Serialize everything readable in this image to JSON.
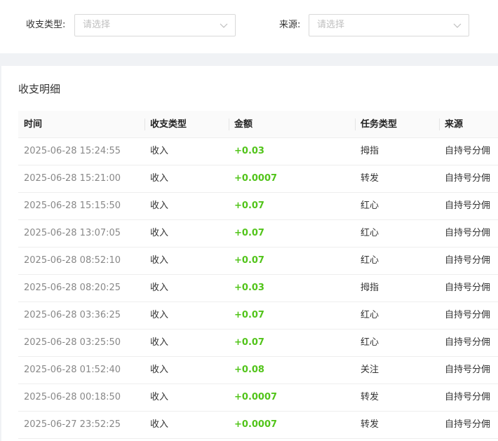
{
  "filters": {
    "type_label": "收支类型:",
    "type_placeholder": "请选择",
    "source_label": "来源:",
    "source_placeholder": "请选择"
  },
  "panel": {
    "title": "收支明细"
  },
  "table": {
    "columns": [
      "时间",
      "收支类型",
      "金额",
      "任务类型",
      "来源"
    ],
    "rows": [
      {
        "time": "2025-06-28 15:24:55",
        "type": "收入",
        "amount": "+0.03",
        "task": "拇指",
        "source": "自持号分佣"
      },
      {
        "time": "2025-06-28 15:21:00",
        "type": "收入",
        "amount": "+0.0007",
        "task": "转发",
        "source": "自持号分佣"
      },
      {
        "time": "2025-06-28 15:15:50",
        "type": "收入",
        "amount": "+0.07",
        "task": "红心",
        "source": "自持号分佣"
      },
      {
        "time": "2025-06-28 13:07:05",
        "type": "收入",
        "amount": "+0.07",
        "task": "红心",
        "source": "自持号分佣"
      },
      {
        "time": "2025-06-28 08:52:10",
        "type": "收入",
        "amount": "+0.07",
        "task": "红心",
        "source": "自持号分佣"
      },
      {
        "time": "2025-06-28 08:20:25",
        "type": "收入",
        "amount": "+0.03",
        "task": "拇指",
        "source": "自持号分佣"
      },
      {
        "time": "2025-06-28 03:36:25",
        "type": "收入",
        "amount": "+0.07",
        "task": "红心",
        "source": "自持号分佣"
      },
      {
        "time": "2025-06-28 03:25:50",
        "type": "收入",
        "amount": "+0.07",
        "task": "红心",
        "source": "自持号分佣"
      },
      {
        "time": "2025-06-28 01:52:40",
        "type": "收入",
        "amount": "+0.08",
        "task": "关注",
        "source": "自持号分佣"
      },
      {
        "time": "2025-06-28 00:18:50",
        "type": "收入",
        "amount": "+0.0007",
        "task": "转发",
        "source": "自持号分佣"
      },
      {
        "time": "2025-06-27 23:52:25",
        "type": "收入",
        "amount": "+0.0007",
        "task": "转发",
        "source": "自持号分佣"
      }
    ]
  },
  "colors": {
    "amount_positive": "#52c41a",
    "placeholder": "#bfbfbf",
    "header_bg": "#fafafa"
  },
  "icons": {
    "select_arrow": "chevron-down-icon"
  }
}
